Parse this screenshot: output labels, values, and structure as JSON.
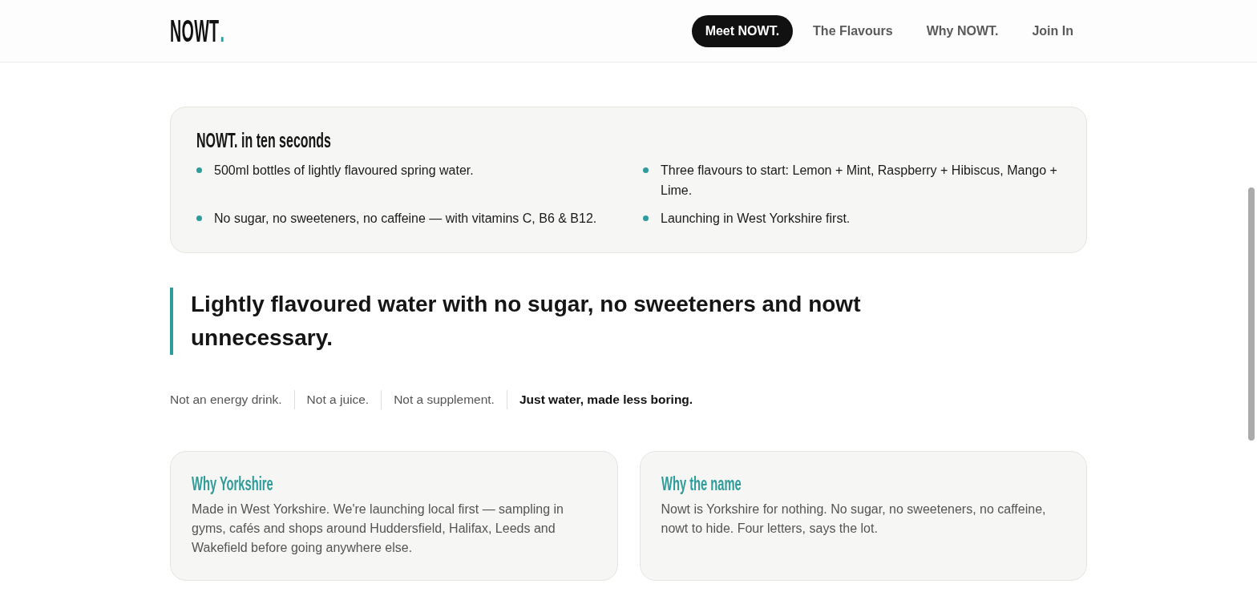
{
  "header": {
    "logo": {
      "text": "NOWT",
      "mark": "."
    },
    "nav": [
      {
        "label": "Meet NOWT.",
        "selected": true
      },
      {
        "label": "The Flavours",
        "selected": false
      },
      {
        "label": "Why NOWT.",
        "selected": false
      },
      {
        "label": "Join In",
        "selected": false
      }
    ]
  },
  "summary": {
    "title": "NOWT. in ten seconds",
    "items": [
      "500ml bottles of lightly flavoured spring water.",
      "Three flavours to start: Lemon + Mint, Raspberry + Hibiscus, Mango + Lime.",
      "No sugar, no sweeteners, no caffeine — with vitamins C, B6 & B12.",
      "Launching in West Yorkshire first."
    ]
  },
  "quote": "Lightly flavoured water with no sugar, no sweeteners and nowt unnecessary.",
  "taglines": [
    {
      "text": "Not an energy drink.",
      "emphasized": false
    },
    {
      "text": "Not a juice.",
      "emphasized": false
    },
    {
      "text": "Not a supplement.",
      "emphasized": false
    },
    {
      "text": "Just water, made less boring.",
      "emphasized": true
    }
  ],
  "cards": [
    {
      "title": "Why Yorkshire",
      "body": "Made in West Yorkshire. We're launching local first — sampling in gyms, cafés and shops around Huddersfield, Halifax, Leeds and Wakefield before going anywhere else."
    },
    {
      "title": "Why the name",
      "body": "Nowt is Yorkshire for nothing. No sugar, no sweeteners, no caffeine, nowt to hide. Four letters, says the lot."
    }
  ]
}
